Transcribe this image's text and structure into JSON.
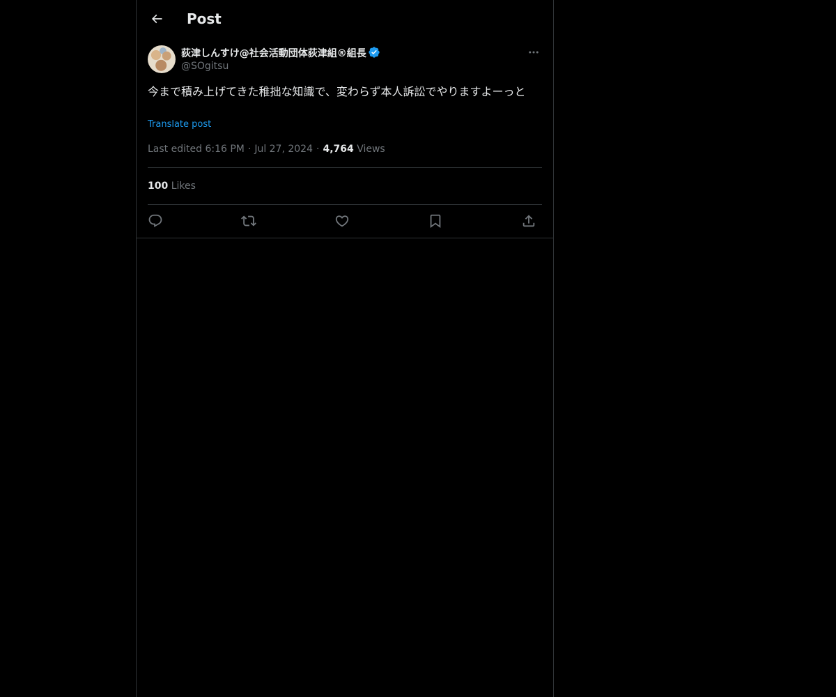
{
  "header": {
    "title": "Post",
    "back_icon": "arrow-left-icon"
  },
  "author": {
    "display_name": "荻津しんすけ@社会活動団体荻津組®組長",
    "handle": "@SOgitsu",
    "verified": true,
    "verified_icon": "verified-badge-icon",
    "more_icon": "more-horizontal-icon"
  },
  "post": {
    "text": "今まで積み上げてきた稚拙な知識で、変わらず本人訴訟でやりますよーっと",
    "translate_label": "Translate post",
    "edited_label": "Last edited 6:16 PM",
    "separator": "·",
    "date": "Jul 27, 2024",
    "views_count": "4,764",
    "views_label": "Views"
  },
  "engagement": {
    "likes_count": "100",
    "likes_label": "Likes"
  },
  "actions": [
    {
      "name": "reply",
      "icon": "reply-icon"
    },
    {
      "name": "repost",
      "icon": "repost-icon"
    },
    {
      "name": "like",
      "icon": "heart-icon"
    },
    {
      "name": "bookmark",
      "icon": "bookmark-icon"
    },
    {
      "name": "share",
      "icon": "share-icon"
    }
  ],
  "colors": {
    "background": "#000000",
    "text": "#e7e9ea",
    "muted": "#71767b",
    "accent": "#1d9bf0",
    "border": "#2f3336"
  }
}
